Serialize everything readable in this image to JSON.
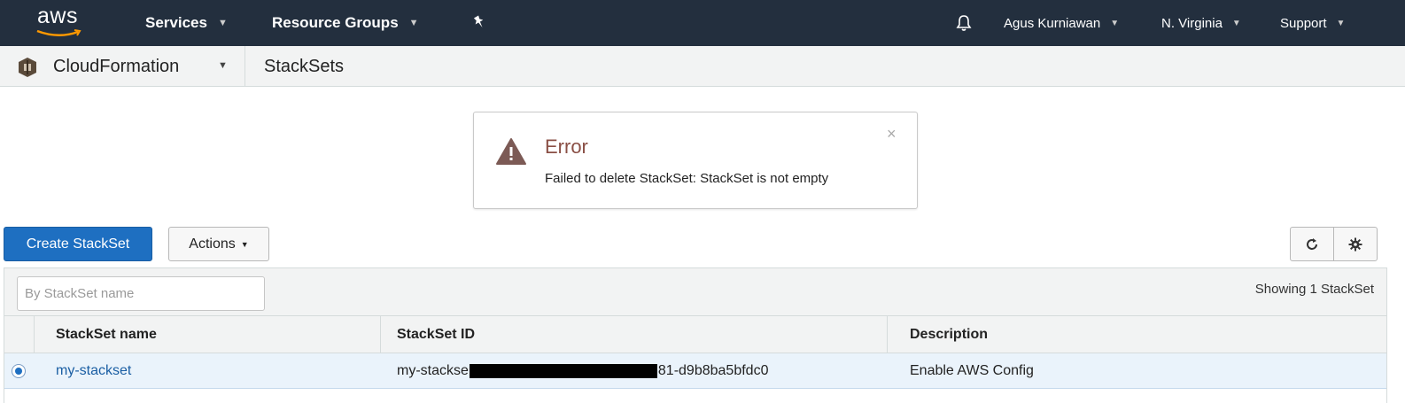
{
  "topnav": {
    "logo_text": "aws",
    "services_label": "Services",
    "resource_groups_label": "Resource Groups",
    "pin_icon": "pin-icon",
    "bell_icon": "bell-icon",
    "user_label": "Agus Kurniawan",
    "region_label": "N. Virginia",
    "support_label": "Support",
    "background": "#232f3e"
  },
  "subnav": {
    "service_label": "CloudFormation",
    "breadcrumb": "StackSets"
  },
  "flash": {
    "title": "Error",
    "message": "Failed to delete StackSet: StackSet is not empty",
    "close": "×",
    "title_color": "#8a4f45"
  },
  "toolbar": {
    "create_label": "Create StackSet",
    "actions_label": "Actions",
    "refresh_icon": "refresh-icon",
    "settings_icon": "gear-icon",
    "primary_color": "#1e6fc1"
  },
  "table": {
    "filter_placeholder": "By StackSet name",
    "showing_text": "Showing 1 StackSet",
    "columns": [
      "StackSet name",
      "StackSet ID",
      "Description"
    ],
    "rows": [
      {
        "selected": true,
        "name": "my-stackset",
        "id_prefix": "my-stackse",
        "id_suffix": "81-d9b8ba5bfdc0",
        "description": "Enable AWS Config"
      }
    ]
  }
}
